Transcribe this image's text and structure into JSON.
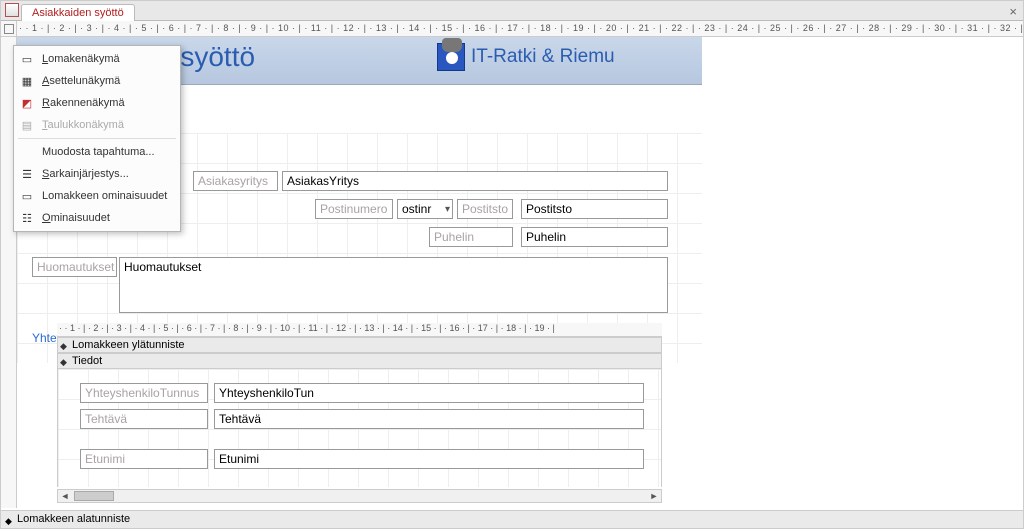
{
  "tab": {
    "title": "Asiakkaiden syöttö"
  },
  "header": {
    "title_fragment": "n syöttö",
    "brand": "IT-Ratki & Riemu"
  },
  "ruler_h": "· · 1 · | · 2 · | · 3 · | · 4 · | · 5 · | · 6 · | · 7 · | · 8 · | · 9 · | · 10 · | · 11 · | · 12 · | · 13 · | · 14 · | · 15 · | · 16 · | · 17 · | · 18 · | · 19 · | · 20 · | · 21 · | · 22 · | · 23 · | · 24 · | · 25 · | · 26 · | · 27 · | · 28 · | · 29 · | · 30 · | · 31 · | · 32 · | · 3",
  "sub_ruler": "· · 1 · | · 2 · | · 3 · | · 4 · | · 5 · | · 6 · | · 7 · | · 8 · | · 9 · | · 10 · | · 11 · | · 12 · | · 13 · | · 14 · | · 15 · | · 16 · | · 17 · | · 18 · | · 19 · |",
  "context_menu": {
    "items": [
      {
        "label": "Lomakenäkymä",
        "icon": "▭",
        "disabled": false
      },
      {
        "label": "Asettelunäkymä",
        "icon": "▦",
        "disabled": false
      },
      {
        "label": "Rakennenäkymä",
        "icon": "◩",
        "disabled": false
      },
      {
        "label": "Taulukkonäkymä",
        "icon": "▤",
        "disabled": true
      }
    ],
    "items2": [
      {
        "label": "Muodosta tapahtuma...",
        "icon": "",
        "disabled": false
      },
      {
        "label": "Sarkainjärjestys...",
        "icon": "☰",
        "disabled": false
      },
      {
        "label": "Lomakkeen ominaisuudet",
        "icon": "▭",
        "disabled": false
      },
      {
        "label": "Ominaisuudet",
        "icon": "☷",
        "disabled": false
      }
    ]
  },
  "fields": {
    "asiakasyritys_label": "Asiakasyritys",
    "asiakasyritys_value": "AsiakasYritys",
    "postinumero_label": "Postinumero",
    "postinumero_value": "ostinr",
    "postitsto_label": "Postitsto",
    "postitsto_value": "Postitsto",
    "puhelin_label": "Puhelin",
    "puhelin_value": "Puhelin",
    "huomautukset_label": "Huomautukset",
    "huomautukset_value": "Huomautukset",
    "yhteyshenkilot": "Yhteyshenkilöt"
  },
  "sections": {
    "ylatunniste": "Lomakkeen ylätunniste",
    "tiedot": "Tiedot",
    "alatunniste": "Lomakkeen alatunniste"
  },
  "subform": {
    "yht_label": "YhteyshenkiloTunnus",
    "yht_value": "YhteyshenkiloTun",
    "tehtava_label": "Tehtävä",
    "tehtava_value": "Tehtävä",
    "etunimi_label": "Etunimi",
    "etunimi_value": "Etunimi"
  }
}
